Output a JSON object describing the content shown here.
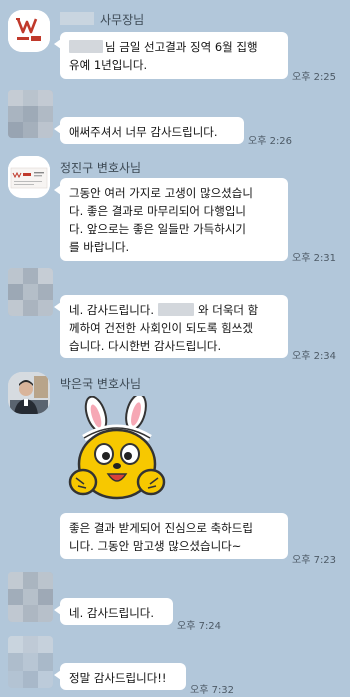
{
  "theme": {
    "chat_bg": "#b2c7da",
    "bubble_bg": "#ffffff",
    "logo_red": "#c0392b",
    "emoticon_yellow": "#f7c800"
  },
  "messages": [
    {
      "sender": "사무장님",
      "avatar": "law-firm-logo",
      "lines": [
        "님 금일 선고결과 징역 6월 집행",
        "유예 1년입니다."
      ],
      "time": "오후 2:25"
    },
    {
      "sender": "",
      "avatar": "blurred",
      "lines": [
        "애써주셔서 너무 감사드립니다."
      ],
      "time": "오후 2:26"
    },
    {
      "sender": "정진구 변호사님",
      "avatar": "business-card",
      "lines": [
        "그동안 여러 가지로 고생이 많으셨습니",
        "다. 좋은 결과로 마무리되어 다행입니",
        "다. 앞으로는 좋은 일들만 가득하시기",
        "를 바랍니다."
      ],
      "time": "오후 2:31"
    },
    {
      "sender": "",
      "avatar": "blurred",
      "lines": [
        "네. 감사드립니다.",
        "와 더욱더 함",
        "께하여 건전한 사회인이 되도록 힘쓰겠",
        "습니다. 다시한번 감사드립니다."
      ],
      "time": "오후 2:34"
    },
    {
      "sender": "박은국 변호사님",
      "avatar": "person-photo",
      "emoticon": "bunny-ears-emoticon",
      "lines": [
        "좋은 결과 받게되어 진심으로 축하드립",
        "니다. 그동안 맘고생 많으셨습니다~"
      ],
      "time": "오후 7:23"
    },
    {
      "sender": "",
      "avatar": "blurred",
      "lines": [
        "네. 감사드립니다."
      ],
      "time": "오후 7:24"
    },
    {
      "sender": "",
      "avatar": "blurred",
      "lines": [
        "정말 감사드립니다!!"
      ],
      "time": "오후 7:32"
    }
  ]
}
